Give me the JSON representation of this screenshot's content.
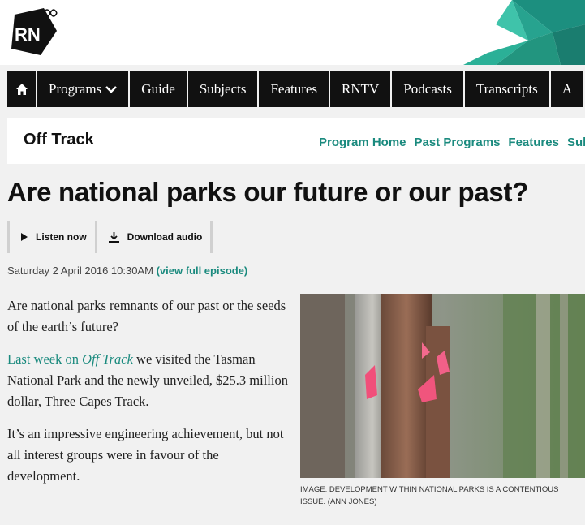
{
  "header": {
    "logo_text": "RN",
    "logo_alt": "ABC Radio National"
  },
  "nav": {
    "home_icon": "home-icon",
    "items": [
      "Programs",
      "Guide",
      "Subjects",
      "Features",
      "RNTV",
      "Podcasts",
      "Transcripts",
      "A"
    ]
  },
  "program": {
    "title": "Off Track",
    "links": [
      "Program Home",
      "Past Programs",
      "Features",
      "Subs"
    ]
  },
  "article": {
    "title": "Are national parks our future or our past?",
    "listen_label": "Listen now",
    "download_label": "Download audio",
    "date": "Saturday 2 April 2016 10:30AM",
    "episode_link": "(view full episode)",
    "p1": "Are national parks remnants of our past or the seeds of the earth’s future?",
    "p2_link_pre": "Last week on ",
    "p2_link_em": "Off Track",
    "p2_rest": " we visited the Tasman National Park and the newly unveiled, $25.3 million dollar, Three Capes Track.",
    "p3": "It’s an impressive engineering achievement, but not all interest groups were in favour of the development.",
    "image_caption": "Image: Development within national parks is a contentious issue. (Ann Jones)"
  },
  "colors": {
    "accent": "#1a8a7e",
    "nav_bg": "#111111",
    "page_bg": "#f1f1f1",
    "logo_green": "#1a8a7e"
  }
}
